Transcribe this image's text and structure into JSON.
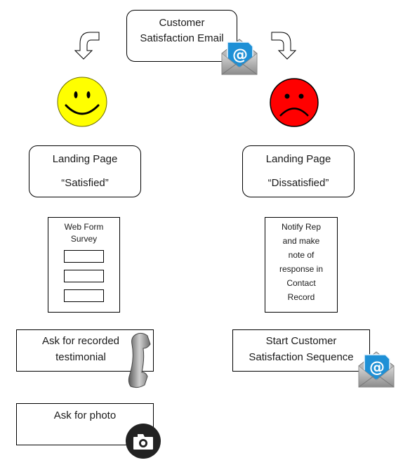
{
  "title_node": {
    "line1": "Customer",
    "line2": "Satisfaction Email"
  },
  "satisfied_branch": {
    "face": "happy-face",
    "landing_page": {
      "line1": "Landing Page",
      "line2": "“Satisfied”"
    },
    "web_form": {
      "line1": "Web Form",
      "line2": "Survey",
      "field_count": 3
    },
    "testimonial": {
      "line1": "Ask for recorded",
      "line2": "testimonial"
    },
    "photo": {
      "line1": "Ask for photo"
    }
  },
  "dissatisfied_branch": {
    "face": "sad-face",
    "landing_page": {
      "line1": "Landing Page",
      "line2": "“Dissatisfied”"
    },
    "notify": {
      "lines": [
        "Notify Rep",
        "and make",
        "note of",
        "response in",
        "Contact",
        "Record"
      ]
    },
    "sequence": {
      "line1": "Start Customer",
      "line2": "Satisfaction Sequence"
    }
  },
  "colors": {
    "happy": "#ffff00",
    "sad": "#ff0000",
    "email_blue": "#1e90d6"
  }
}
